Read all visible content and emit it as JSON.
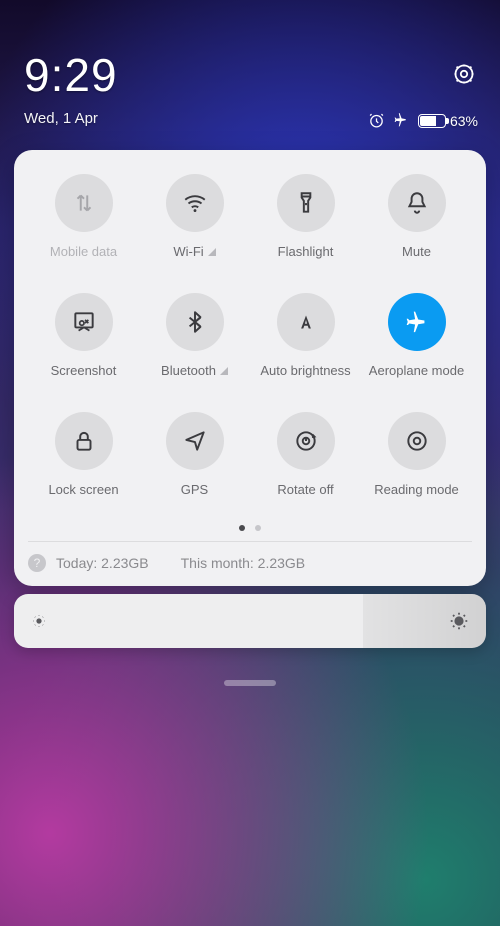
{
  "header": {
    "time": "9:29",
    "date": "Wed, 1 Apr",
    "battery_percent": "63%"
  },
  "tiles": [
    {
      "label": "Mobile data",
      "icon": "mobile-data-icon",
      "active": false,
      "disabled": true,
      "signal": false
    },
    {
      "label": "Wi-Fi",
      "icon": "wifi-icon",
      "active": false,
      "disabled": false,
      "signal": true
    },
    {
      "label": "Flashlight",
      "icon": "flashlight-icon",
      "active": false,
      "disabled": false,
      "signal": false
    },
    {
      "label": "Mute",
      "icon": "mute-icon",
      "active": false,
      "disabled": false,
      "signal": false
    },
    {
      "label": "Screenshot",
      "icon": "screenshot-icon",
      "active": false,
      "disabled": false,
      "signal": false
    },
    {
      "label": "Bluetooth",
      "icon": "bluetooth-icon",
      "active": false,
      "disabled": false,
      "signal": true
    },
    {
      "label": "Auto brightness",
      "icon": "auto-brightness-icon",
      "active": false,
      "disabled": false,
      "signal": false
    },
    {
      "label": "Aeroplane mode",
      "icon": "airplane-icon",
      "active": true,
      "disabled": false,
      "signal": false
    },
    {
      "label": "Lock screen",
      "icon": "lock-icon",
      "active": false,
      "disabled": false,
      "signal": false
    },
    {
      "label": "GPS",
      "icon": "gps-icon",
      "active": false,
      "disabled": false,
      "signal": false
    },
    {
      "label": "Rotate off",
      "icon": "rotate-icon",
      "active": false,
      "disabled": false,
      "signal": false
    },
    {
      "label": "Reading mode",
      "icon": "reading-icon",
      "active": false,
      "disabled": false,
      "signal": false
    }
  ],
  "usage": {
    "today_label": "Today: ",
    "today_value": "2.23GB",
    "month_label": "This month: ",
    "month_value": "2.23GB"
  },
  "brightness": {
    "level_percent": 74
  }
}
